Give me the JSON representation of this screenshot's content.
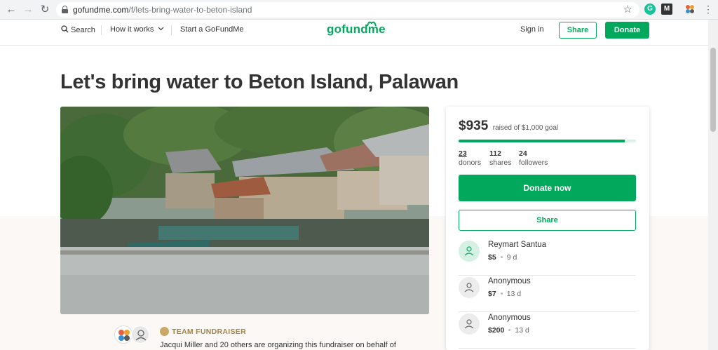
{
  "browser": {
    "url_domain": "gofundme.com",
    "url_path": "/f/lets-bring-water-to-beton-island",
    "extensions": [
      "grammarly-icon",
      "mendeley-icon",
      "puzzle-extension-icon"
    ]
  },
  "header": {
    "search_label": "Search",
    "how_it_works_label": "How it works",
    "start_label": "Start a GoFundMe",
    "logo_text": "gofundme",
    "signin_label": "Sign in",
    "share_label": "Share",
    "donate_label": "Donate"
  },
  "campaign": {
    "title": "Let's bring water to Beton Island, Palawan",
    "raised": "$935",
    "goal_text": "raised of $1,000 goal",
    "progress_fraction": 0.935,
    "stats": [
      {
        "value": "23",
        "label": "donors"
      },
      {
        "value": "112",
        "label": "shares"
      },
      {
        "value": "24",
        "label": "followers"
      }
    ],
    "donate_now_label": "Donate now",
    "share_label": "Share",
    "donors": [
      {
        "name": "Reymart Santua",
        "amount": "$5",
        "time": "9 d"
      },
      {
        "name": "Anonymous",
        "amount": "$7",
        "time": "13 d"
      },
      {
        "name": "Anonymous",
        "amount": "$200",
        "time": "13 d"
      }
    ]
  },
  "organizer": {
    "team_label": "TEAM FUNDRAISER",
    "text": "Jacqui Miller and 20 others are organizing this fundraiser on behalf of"
  },
  "colors": {
    "brand_green": "#02a95c",
    "team_gold": "#a0844b"
  }
}
